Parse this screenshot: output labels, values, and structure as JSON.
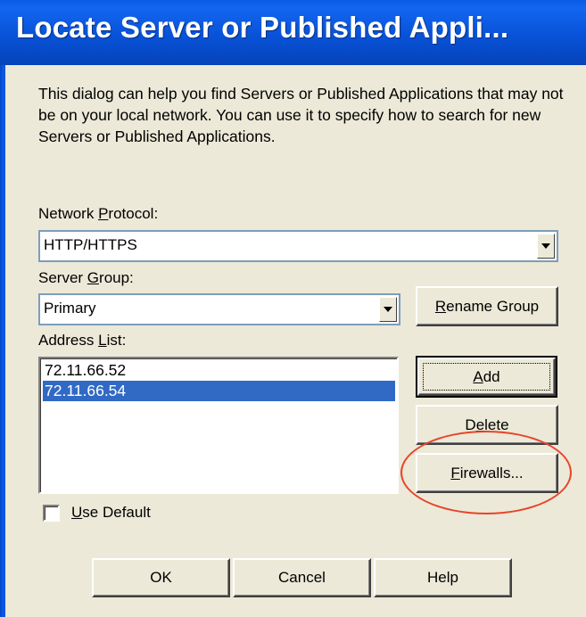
{
  "window": {
    "title": "Locate Server or Published Appli...",
    "description": "This dialog can help you find Servers or Published Applications that may not be on your local network.  You can use it to specify how to search for new Servers or Published Applications."
  },
  "network_protocol": {
    "label_pre": "Network ",
    "label_key": "P",
    "label_post": "rotocol:",
    "value": "HTTP/HTTPS"
  },
  "server_group": {
    "label_pre": "Server ",
    "label_key": "G",
    "label_post": "roup:",
    "value": "Primary"
  },
  "rename_group": {
    "key": "R",
    "rest": "ename Group"
  },
  "address_list": {
    "label_pre": "Address ",
    "label_key": "L",
    "label_post": "ist:",
    "items": [
      {
        "text": "72.11.66.52",
        "selected": false
      },
      {
        "text": "72.11.66.54",
        "selected": true
      }
    ]
  },
  "buttons": {
    "add": {
      "key": "A",
      "rest": "dd"
    },
    "delete": {
      "pre": "D",
      "key": "e",
      "rest": "lete"
    },
    "firewalls": {
      "key": "F",
      "rest": "irewalls..."
    },
    "ok": "OK",
    "cancel": "Cancel",
    "help": "Help"
  },
  "use_default": {
    "key": "U",
    "rest": "se Default",
    "checked": false
  },
  "colors": {
    "highlight": "#316ac5",
    "annotation": "#e8442a",
    "titlebar": "#0a5ae6"
  }
}
